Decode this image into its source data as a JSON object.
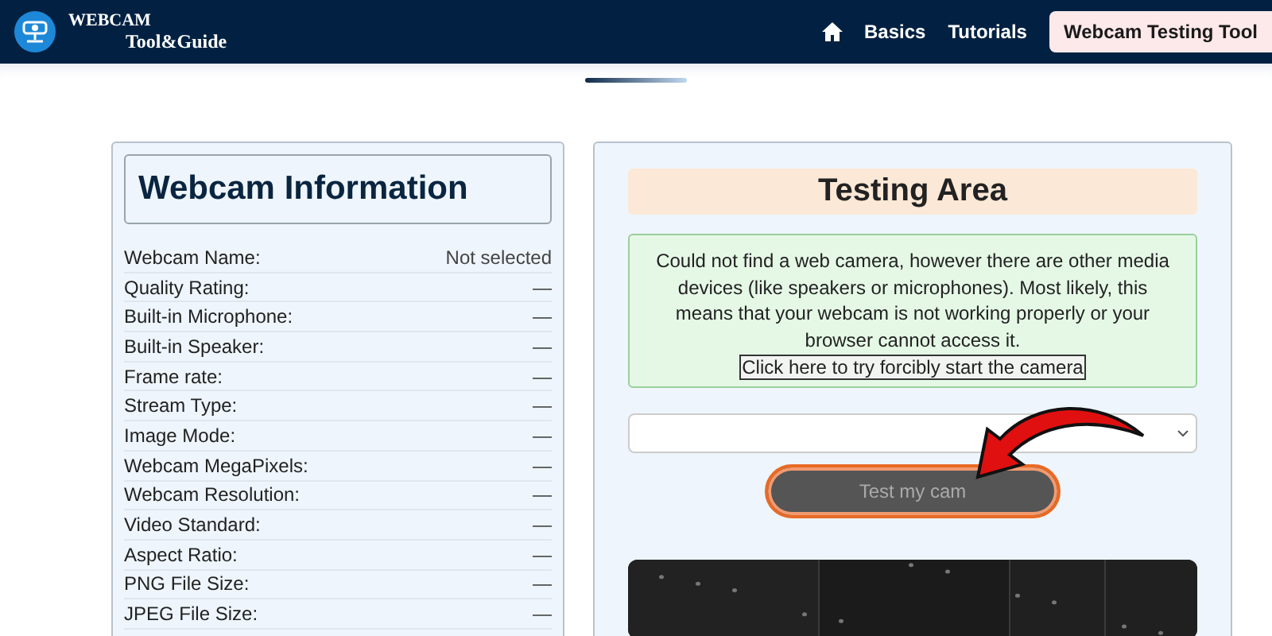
{
  "header": {
    "logo_line1": "WEBCAM",
    "logo_line2": "Tool&Guide",
    "nav": [
      {
        "kind": "icon",
        "selected": false
      },
      {
        "kind": "text",
        "label": "Basics",
        "selected": false
      },
      {
        "kind": "text",
        "label": "Tutorials",
        "selected": false
      },
      {
        "kind": "text",
        "label": "Webcam Testing Tool",
        "selected": true
      }
    ]
  },
  "info_panel": {
    "title": "Webcam Information",
    "rows": [
      {
        "label": "Webcam Name:",
        "value": "Not selected"
      },
      {
        "label": "Quality Rating:",
        "value": "—"
      },
      {
        "label": "Built-in Microphone:",
        "value": "—"
      },
      {
        "label": "Built-in Speaker:",
        "value": "—"
      },
      {
        "label": "Frame rate:",
        "value": "—"
      },
      {
        "label": "Stream Type:",
        "value": "—"
      },
      {
        "label": "Image Mode:",
        "value": "—"
      },
      {
        "label": "Webcam MegaPixels:",
        "value": "—"
      },
      {
        "label": "Webcam Resolution:",
        "value": "—"
      },
      {
        "label": "Video Standard:",
        "value": "—"
      },
      {
        "label": "Aspect Ratio:",
        "value": "—"
      },
      {
        "label": "PNG File Size:",
        "value": "—"
      },
      {
        "label": "JPEG File Size:",
        "value": "—"
      }
    ]
  },
  "testing_panel": {
    "title": "Testing Area",
    "message": "Could not find a web camera, however there are other media devices (like speakers or microphones). Most likely, this means that your webcam is not working properly or your browser cannot access it.",
    "force_link": "Click here to try forcibly start the camera",
    "button": "Test my cam"
  }
}
